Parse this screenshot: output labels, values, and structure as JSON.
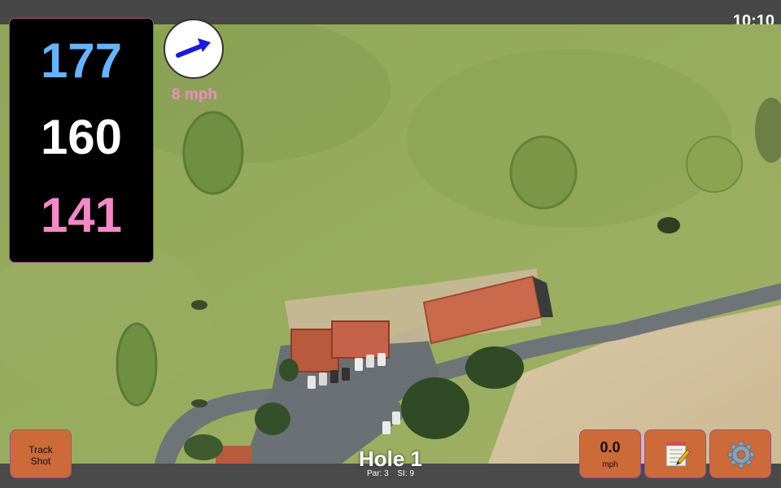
{
  "status_bar": {
    "time": "10:10"
  },
  "distances": {
    "back": "177",
    "middle": "160",
    "front": "141"
  },
  "wind": {
    "speed": "8 mph",
    "direction_icon": "wind-arrow-icon"
  },
  "buttons": {
    "track_shot": {
      "line1": "Track",
      "line2": "Shot"
    },
    "speed": {
      "value": "0.0",
      "unit": "mph"
    },
    "notes_icon": "notepad-icon",
    "settings_icon": "gear-icon"
  },
  "hole": {
    "title": "Hole 1",
    "par": "Par: 3",
    "si": "SI: 9"
  },
  "colors": {
    "back_distance": "#66b3ff",
    "middle_distance": "#ffffff",
    "front_distance": "#f589c8",
    "button_bg": "#cd6a3a",
    "wind_arrow": "#1a1ad8"
  }
}
